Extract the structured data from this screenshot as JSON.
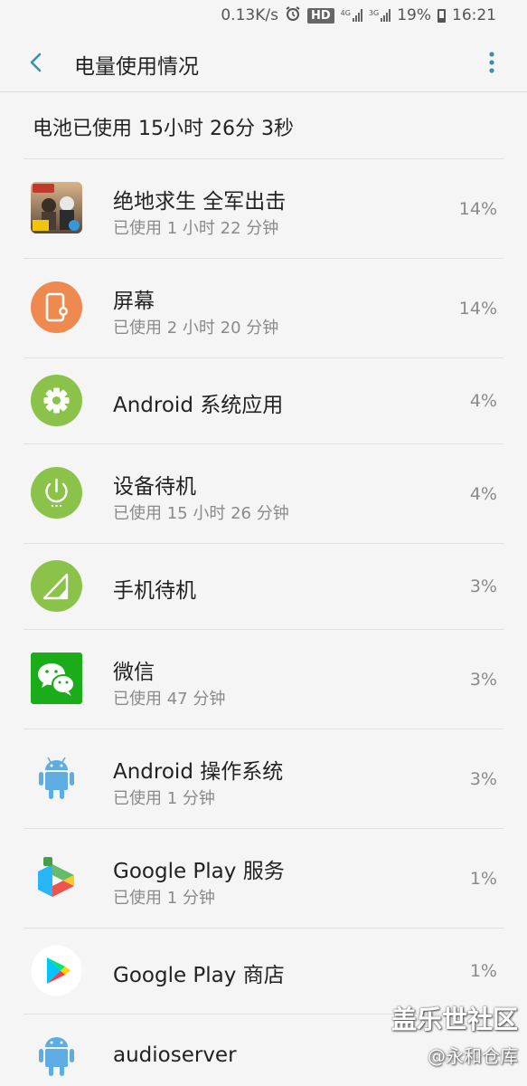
{
  "status_bar": {
    "speed": "0.13K/s",
    "hd": "HD",
    "net1": "4G",
    "net2": "3G",
    "battery": "19%",
    "time": "16:21"
  },
  "header": {
    "title": "电量使用情况"
  },
  "summary": {
    "total": "电池已使用 15小时 26分 3秒"
  },
  "items": [
    {
      "name": "绝地求生 全军出击",
      "usage": "已使用 1 小时 22 分钟",
      "percent": "14%",
      "icon": "pubg-game-icon"
    },
    {
      "name": "屏幕",
      "usage": "已使用 2 小时 20 分钟",
      "percent": "14%",
      "icon": "screen-icon"
    },
    {
      "name": "Android 系统应用",
      "usage": "",
      "percent": "4%",
      "icon": "gear-icon"
    },
    {
      "name": "设备待机",
      "usage": "已使用 15 小时 26 分钟",
      "percent": "4%",
      "icon": "power-icon"
    },
    {
      "name": "手机待机",
      "usage": "",
      "percent": "3%",
      "icon": "signal-icon"
    },
    {
      "name": "微信",
      "usage": "已使用 47 分钟",
      "percent": "3%",
      "icon": "wechat-icon"
    },
    {
      "name": "Android 操作系统",
      "usage": "已使用 1 分钟",
      "percent": "3%",
      "icon": "android-icon"
    },
    {
      "name": "Google Play 服务",
      "usage": "已使用 1 分钟",
      "percent": "1%",
      "icon": "play-services-icon"
    },
    {
      "name": "Google Play 商店",
      "usage": "",
      "percent": "1%",
      "icon": "play-store-icon"
    },
    {
      "name": "audioserver",
      "usage": "",
      "percent": "",
      "icon": "android-icon"
    }
  ],
  "watermark": {
    "main": "盖乐世社区",
    "sub": "@永和仓库"
  },
  "colors": {
    "accent": "#3d8fb0",
    "green": "#8bc34a",
    "orange": "#ee8a4f",
    "wechat": "#1aad19",
    "android": "#5dade2"
  }
}
